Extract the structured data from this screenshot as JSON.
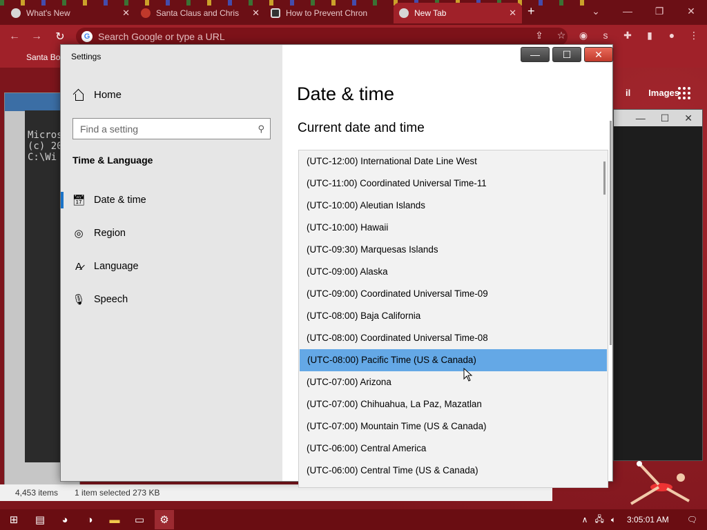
{
  "chrome": {
    "tabs": [
      {
        "title": "What's New"
      },
      {
        "title": "Santa Claus and Chris"
      },
      {
        "title": "How to Prevent Chron"
      },
      {
        "title": "New Tab"
      }
    ],
    "omnibox_placeholder": "Search Google or type a URL",
    "bookmark": "Santa Bo",
    "google_links": [
      "il",
      "Images"
    ]
  },
  "console": {
    "lines": [
      "Micros",
      "(c) 20",
      "",
      "C:\\Wi"
    ]
  },
  "explorer": {
    "items_count": "4,453 items",
    "selection": "1 item selected  273 KB"
  },
  "settings": {
    "window_title": "Settings",
    "home_label": "Home",
    "search_placeholder": "Find a setting",
    "section": "Time & Language",
    "nav": [
      {
        "label": "Date & time",
        "icon": "calendar-clock-icon",
        "selected": true
      },
      {
        "label": "Region",
        "icon": "globe-icon",
        "selected": false
      },
      {
        "label": "Language",
        "icon": "language-icon",
        "selected": false
      },
      {
        "label": "Speech",
        "icon": "microphone-icon",
        "selected": false
      }
    ],
    "page_title": "Date & time",
    "sub_title": "Current date and time",
    "timezones": [
      "(UTC-12:00) International Date Line West",
      "(UTC-11:00) Coordinated Universal Time-11",
      "(UTC-10:00) Aleutian Islands",
      "(UTC-10:00) Hawaii",
      "(UTC-09:30) Marquesas Islands",
      "(UTC-09:00) Alaska",
      "(UTC-09:00) Coordinated Universal Time-09",
      "(UTC-08:00) Baja California",
      "(UTC-08:00) Coordinated Universal Time-08",
      "(UTC-08:00) Pacific Time (US & Canada)",
      "(UTC-07:00) Arizona",
      "(UTC-07:00) Chihuahua, La Paz, Mazatlan",
      "(UTC-07:00) Mountain Time (US & Canada)",
      "(UTC-06:00) Central America",
      "(UTC-06:00) Central Time (US & Canada)"
    ],
    "selected_timezone_index": 9
  },
  "taskbar": {
    "clock": "3:05:01 AM"
  },
  "colors": {
    "accent": "#1a73c8",
    "selection": "#64a8e6",
    "desktop": "#8a1a22"
  }
}
